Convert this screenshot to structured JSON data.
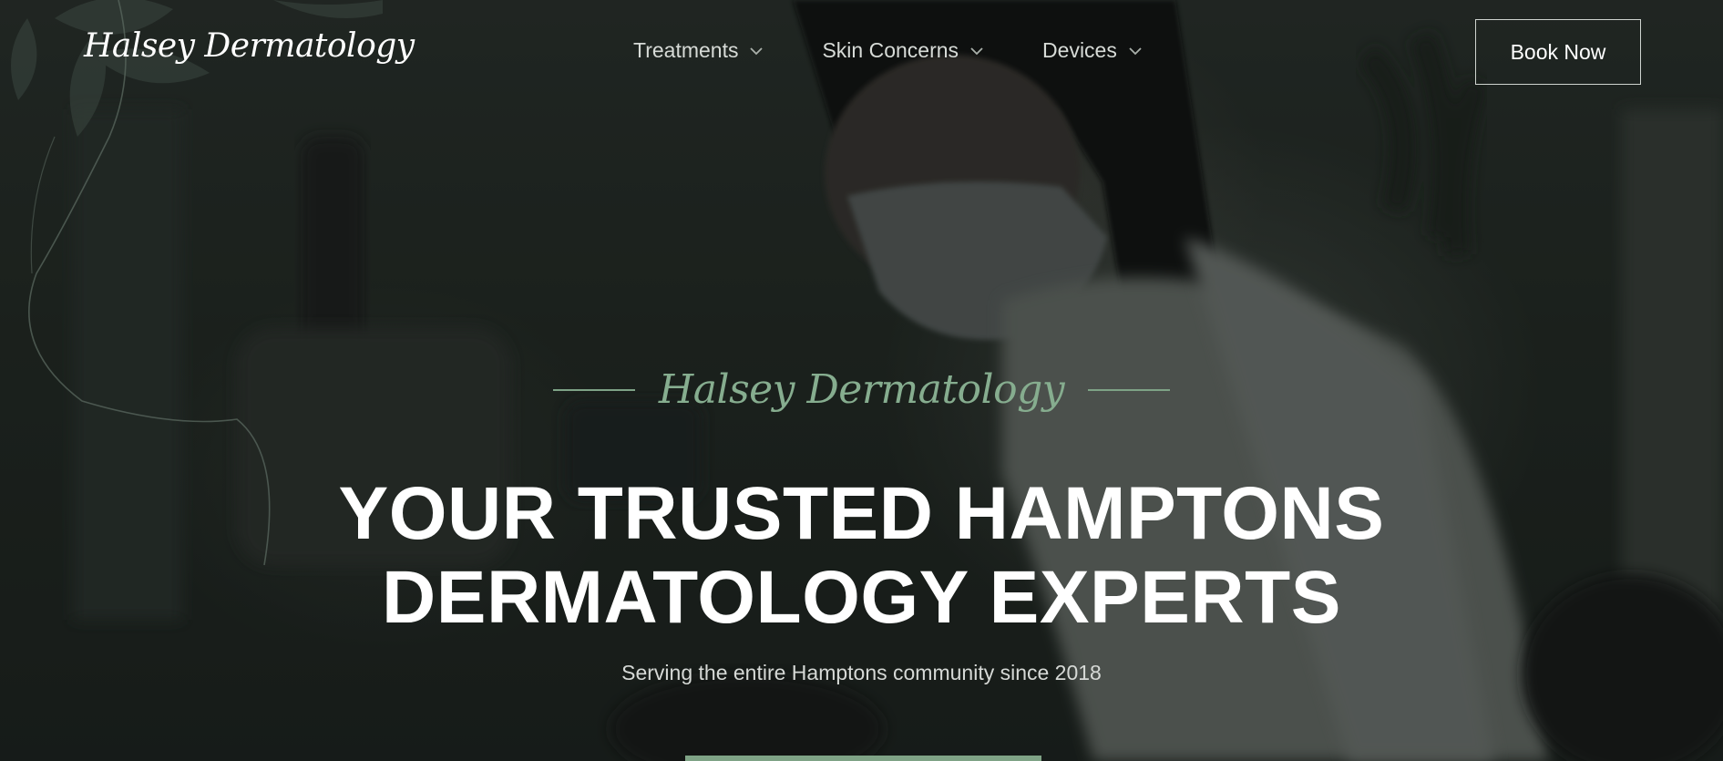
{
  "header": {
    "logo": "Halsey Dermatology",
    "nav": [
      {
        "label": "Treatments",
        "icon": "chevron-down-icon"
      },
      {
        "label": "Skin Concerns",
        "icon": "chevron-down-icon"
      },
      {
        "label": "Devices",
        "icon": "chevron-down-icon"
      }
    ],
    "book_label": "Book Now"
  },
  "hero": {
    "eyebrow": "Halsey Dermatology",
    "headline_line1": "YOUR TRUSTED HAMPTONS",
    "headline_line2": "DERMATOLOGY EXPERTS",
    "subtitle": "Serving the entire Hamptons community since 2018",
    "background": "dermatologist-with-face-mask-photo"
  },
  "colors": {
    "accent": "#7fa386",
    "overlay": "#1b201d",
    "text": "#ffffff"
  }
}
